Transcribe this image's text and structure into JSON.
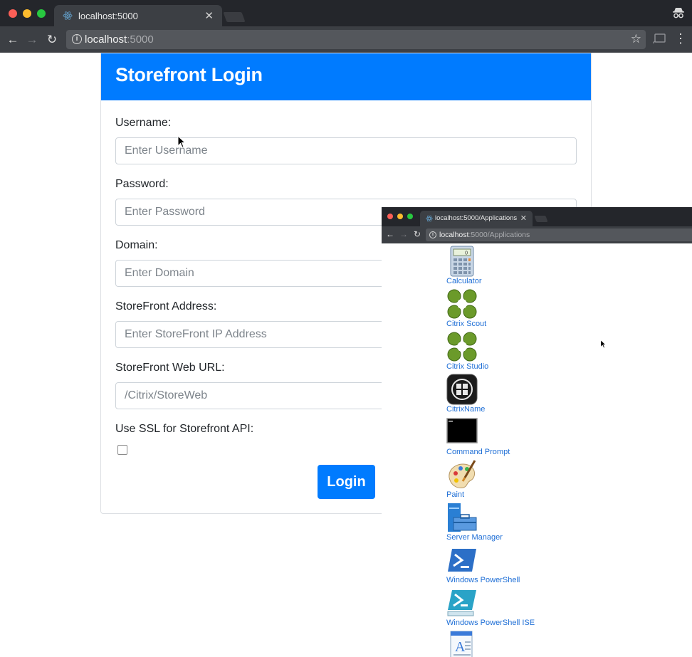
{
  "browser": {
    "tab_title": "localhost:5000",
    "url_host": "localhost",
    "url_port": ":5000"
  },
  "login": {
    "title": "Storefront Login",
    "fields": [
      {
        "label": "Username:",
        "placeholder": "Enter Username"
      },
      {
        "label": "Password:",
        "placeholder": "Enter Password"
      },
      {
        "label": "Domain:",
        "placeholder": "Enter Domain"
      },
      {
        "label": "StoreFront Address:",
        "placeholder": "Enter StoreFront IP Address"
      },
      {
        "label": "StoreFront Web URL:",
        "placeholder": "/Citrix/StoreWeb"
      }
    ],
    "ssl_label": "Use SSL for Storefront API:",
    "ssl_checked": false,
    "login_button": "Login"
  },
  "apps_window": {
    "tab_title": "localhost:5000/Applications",
    "url_host": "localhost",
    "url_path": ":5000/Applications",
    "apps": [
      {
        "label": "Calculator",
        "icon": "calculator-icon"
      },
      {
        "label": "Citrix Scout",
        "icon": "citrix-scout-icon"
      },
      {
        "label": "Citrix Studio",
        "icon": "citrix-studio-icon"
      },
      {
        "label": "CitrixName",
        "icon": "windows-logo-icon"
      },
      {
        "label": "Command Prompt",
        "icon": "command-prompt-icon"
      },
      {
        "label": "Paint",
        "icon": "paint-palette-icon"
      },
      {
        "label": "Server Manager",
        "icon": "server-manager-icon"
      },
      {
        "label": "Windows PowerShell",
        "icon": "powershell-icon"
      },
      {
        "label": "Windows PowerShell ISE",
        "icon": "powershell-ise-icon"
      },
      {
        "label": "",
        "icon": "wordpad-icon"
      }
    ]
  },
  "colors": {
    "brand_blue": "#007bff",
    "link_blue": "#1f6fd6",
    "chrome_dark": "#24262b",
    "chrome_toolbar": "#3c3f44"
  }
}
